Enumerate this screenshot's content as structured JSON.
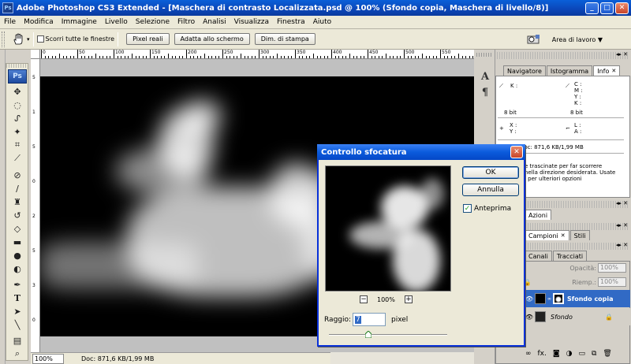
{
  "window": {
    "title": "Adobe Photoshop CS3 Extended - [Maschera di contrasto Localizzata.psd @ 100% (Sfondo copia, Maschera di livello/8)]",
    "app_badge": "Ps",
    "minimize_glyph": "_",
    "maximize_glyph": "□",
    "close_glyph": "✕"
  },
  "menu": [
    "File",
    "Modifica",
    "Immagine",
    "Livello",
    "Selezione",
    "Filtro",
    "Analisi",
    "Visualizza",
    "Finestra",
    "Aiuto"
  ],
  "options": {
    "tool_icon": "hand-icon",
    "scroll_all_label": "Scorri tutte le finestre",
    "scroll_all_checked": false,
    "buttons": [
      "Pixel reali",
      "Adatta allo schermo",
      "Dim. di stampa"
    ],
    "workspace_label": "Area di lavoro ▼"
  },
  "toolbox": {
    "badge": "Ps",
    "tools": [
      "move-icon",
      "marquee-icon",
      "lasso-icon",
      "magic-wand-icon",
      "crop-icon",
      "eyedropper-icon",
      "healing-icon",
      "brush-icon",
      "clone-stamp-icon",
      "history-brush-icon",
      "eraser-icon",
      "gradient-icon",
      "blur-icon",
      "dodge-icon",
      "pen-icon",
      "type-icon",
      "path-select-icon",
      "line-icon",
      "notes-icon",
      "zoom-icon"
    ],
    "type_glyph": "T"
  },
  "document": {
    "ruler_h": [
      "0",
      "50",
      "100",
      "150",
      "200",
      "250",
      "300",
      "350",
      "400",
      "450",
      "500",
      "550"
    ],
    "ruler_v": [
      "5",
      "1",
      "5",
      "0",
      "2",
      "5",
      "3",
      "0"
    ],
    "zoom": "100%",
    "doc_info": "Doc: 871,6 KB/1,99 MB"
  },
  "panels": {
    "nav_tabs": [
      {
        "label": "Navigatore",
        "active": false
      },
      {
        "label": "Istogramma",
        "active": false
      },
      {
        "label": "Info",
        "active": true
      }
    ],
    "info": {
      "k_label": "K :",
      "bits_left": "8 bit",
      "cmyk": "C :\nM :\nY :\nK :",
      "bits_right": "8 bit",
      "xy": "X :\nY :",
      "lh": "L :\nA :",
      "doc": "Doc: 871,6 KB/1,99 MB",
      "hint": "e trascinate per far scorrere\nnella direzione desiderata. Usate\nl per ulteriori opzioni"
    },
    "actions_tabs": [
      {
        "label": "Azioni",
        "active": false
      }
    ],
    "swatch_tabs": [
      {
        "label": "Campioni",
        "active": true
      },
      {
        "label": "Stili",
        "active": false
      }
    ],
    "layer_tabs": [
      {
        "label": "Canali",
        "active": false
      },
      {
        "label": "Tracciati",
        "active": false
      }
    ],
    "opacity_label": "Opacità:",
    "opacity_value": "100%",
    "fill_label": "Riemp.:",
    "fill_value": "100%",
    "layers": [
      {
        "name": "Sfondo copia",
        "selected": true
      },
      {
        "name": "Sfondo",
        "selected": false
      }
    ],
    "layer_footer": "fx."
  },
  "dialog": {
    "title": "Controllo sfocatura",
    "close_glyph": "✕",
    "ok_label": "OK",
    "cancel_label": "Annulla",
    "preview_label": "Anteprima",
    "preview_checked": true,
    "zoom_value": "100%",
    "zoom_minus": "−",
    "zoom_plus": "+",
    "radius_label": "Raggio:",
    "radius_value": "7",
    "radius_unit": "pixel",
    "radius_slider_fraction": 0.33
  }
}
